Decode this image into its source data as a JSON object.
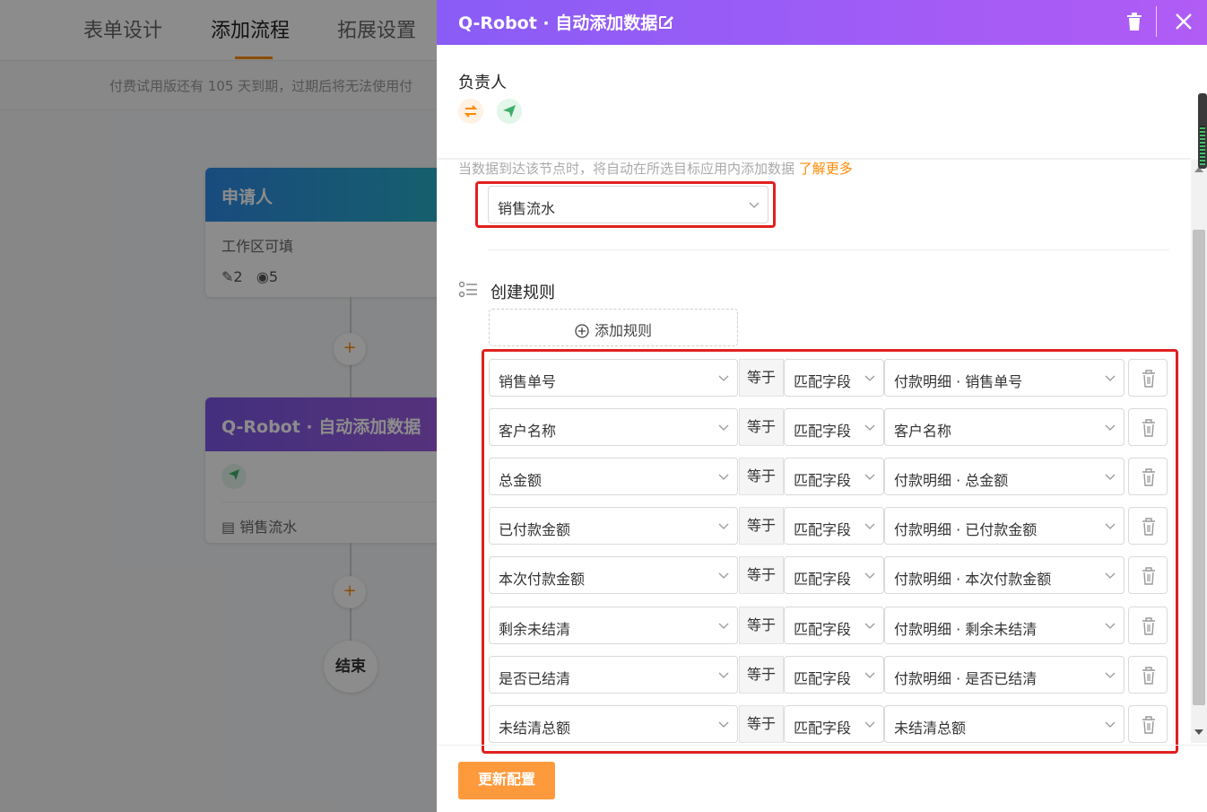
{
  "background": {
    "tabs": [
      "表单设计",
      "添加流程",
      "拓展设置"
    ],
    "active_tab": "添加流程",
    "notice": "付费试用版还有 105 天到期，过期后将无法使用付",
    "applicant_node": {
      "title": "申请人",
      "body": "工作区可填",
      "edit_count": "2",
      "view_count": "5"
    },
    "robot_node": {
      "title": "Q-Robot · 自动添加数据",
      "target": "销售流水"
    },
    "end_label": "结束",
    "plus": "+"
  },
  "drawer": {
    "title": "Q-Robot · 自动添加数据",
    "owner_label": "负责人",
    "description": "当数据到达该节点时，将自动在所选目标应用内添加数据",
    "learn_more": "了解更多",
    "target_app": "销售流水",
    "rules_title": "创建规则",
    "add_rule_label": "添加规则",
    "update_button": "更新配置",
    "rules": [
      {
        "field": "销售单号",
        "operator": "等于",
        "type": "匹配字段",
        "value": "付款明细 · 销售单号"
      },
      {
        "field": "客户名称",
        "operator": "等于",
        "type": "匹配字段",
        "value": "客户名称"
      },
      {
        "field": "总金额",
        "operator": "等于",
        "type": "匹配字段",
        "value": "付款明细 · 总金额"
      },
      {
        "field": "已付款金额",
        "operator": "等于",
        "type": "匹配字段",
        "value": "付款明细 · 已付款金额"
      },
      {
        "field": "本次付款金额",
        "operator": "等于",
        "type": "匹配字段",
        "value": "付款明细 · 本次付款金额"
      },
      {
        "field": "剩余未结清",
        "operator": "等于",
        "type": "匹配字段",
        "value": "付款明细 · 剩余未结清"
      },
      {
        "field": "是否已结清",
        "operator": "等于",
        "type": "匹配字段",
        "value": "付款明细 · 是否已结清"
      },
      {
        "field": "未结清总额",
        "operator": "等于",
        "type": "匹配字段",
        "value": "未结清总额"
      }
    ]
  },
  "colors": {
    "header_gradient_start": "#8a5cf6",
    "header_gradient_end": "#b05cf5",
    "accent_orange": "#ff8a00",
    "button_orange": "#ff9a3c",
    "highlight_red": "#e02020"
  },
  "icons": [
    "edit-icon",
    "trash-icon",
    "close-icon",
    "swap-icon",
    "send-icon",
    "list-icon",
    "plus-circle-icon",
    "chevron-down-icon"
  ]
}
